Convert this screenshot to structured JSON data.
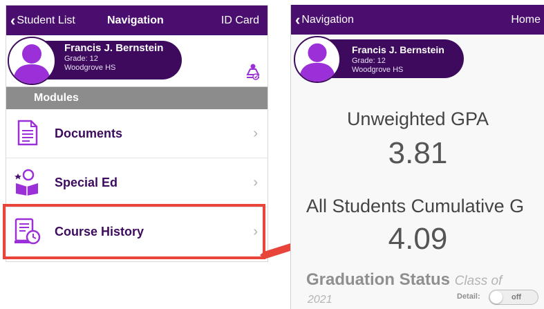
{
  "left_screen": {
    "nav": {
      "back_label": "Student List",
      "title": "Navigation",
      "right_label": "ID Card"
    },
    "profile": {
      "name": "Francis J. Bernstein",
      "grade": "Grade: 12",
      "school": "Woodgrove HS",
      "switch_icon": "student-switch-icon"
    },
    "modules_header": "Modules",
    "modules": [
      {
        "label": "Documents",
        "icon": "document-icon"
      },
      {
        "label": "Special Ed",
        "icon": "reading-student-icon"
      },
      {
        "label": "Course History",
        "icon": "course-history-icon"
      }
    ]
  },
  "right_screen": {
    "nav": {
      "back_label": "Navigation",
      "right_label": "Home"
    },
    "profile": {
      "name": "Francis J. Bernstein",
      "grade": "Grade: 12",
      "school": "Woodgrove HS"
    },
    "unweighted_gpa_label": "Unweighted GPA",
    "unweighted_gpa_value": "3.81",
    "cumulative_gpa_label": "All Students Cumulative G",
    "cumulative_gpa_value": "4.09",
    "graduation_status_label": "Graduation Status",
    "class_of_label": "Class of",
    "class_year": "2021",
    "detail_label": "Detail:",
    "detail_toggle_state": "off"
  },
  "colors": {
    "brand_purple": "#4a0e6e",
    "icon_purple": "#9b30d9",
    "highlight_red": "#e8443a",
    "modules_gray": "#8c8c8c"
  }
}
